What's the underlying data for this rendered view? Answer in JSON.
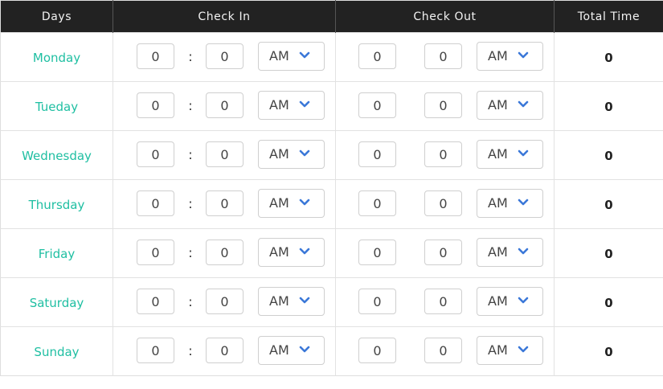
{
  "headers": {
    "days": "Days",
    "check_in": "Check In",
    "check_out": "Check Out",
    "total_time": "Total Time"
  },
  "separator": ":",
  "rows": [
    {
      "day": "Monday",
      "in_hour": "0",
      "in_min": "0",
      "in_period": "AM",
      "out_hour": "0",
      "out_min": "0",
      "out_period": "AM",
      "total": "0"
    },
    {
      "day": "Tueday",
      "in_hour": "0",
      "in_min": "0",
      "in_period": "AM",
      "out_hour": "0",
      "out_min": "0",
      "out_period": "AM",
      "total": "0"
    },
    {
      "day": "Wednesday",
      "in_hour": "0",
      "in_min": "0",
      "in_period": "AM",
      "out_hour": "0",
      "out_min": "0",
      "out_period": "AM",
      "total": "0"
    },
    {
      "day": "Thursday",
      "in_hour": "0",
      "in_min": "0",
      "in_period": "AM",
      "out_hour": "0",
      "out_min": "0",
      "out_period": "AM",
      "total": "0"
    },
    {
      "day": "Friday",
      "in_hour": "0",
      "in_min": "0",
      "in_period": "AM",
      "out_hour": "0",
      "out_min": "0",
      "out_period": "AM",
      "total": "0"
    },
    {
      "day": "Saturday",
      "in_hour": "0",
      "in_min": "0",
      "in_period": "AM",
      "out_hour": "0",
      "out_min": "0",
      "out_period": "AM",
      "total": "0"
    },
    {
      "day": "Sunday",
      "in_hour": "0",
      "in_min": "0",
      "in_period": "AM",
      "out_hour": "0",
      "out_min": "0",
      "out_period": "AM",
      "total": "0"
    }
  ],
  "icons": {
    "period_select": "chevron-down-icon"
  },
  "colors": {
    "header_bg": "#222222",
    "header_text": "#f2f2f2",
    "day_text": "#1fbfa2",
    "chevron": "#3b78d8",
    "border": "#e2e2e2"
  }
}
